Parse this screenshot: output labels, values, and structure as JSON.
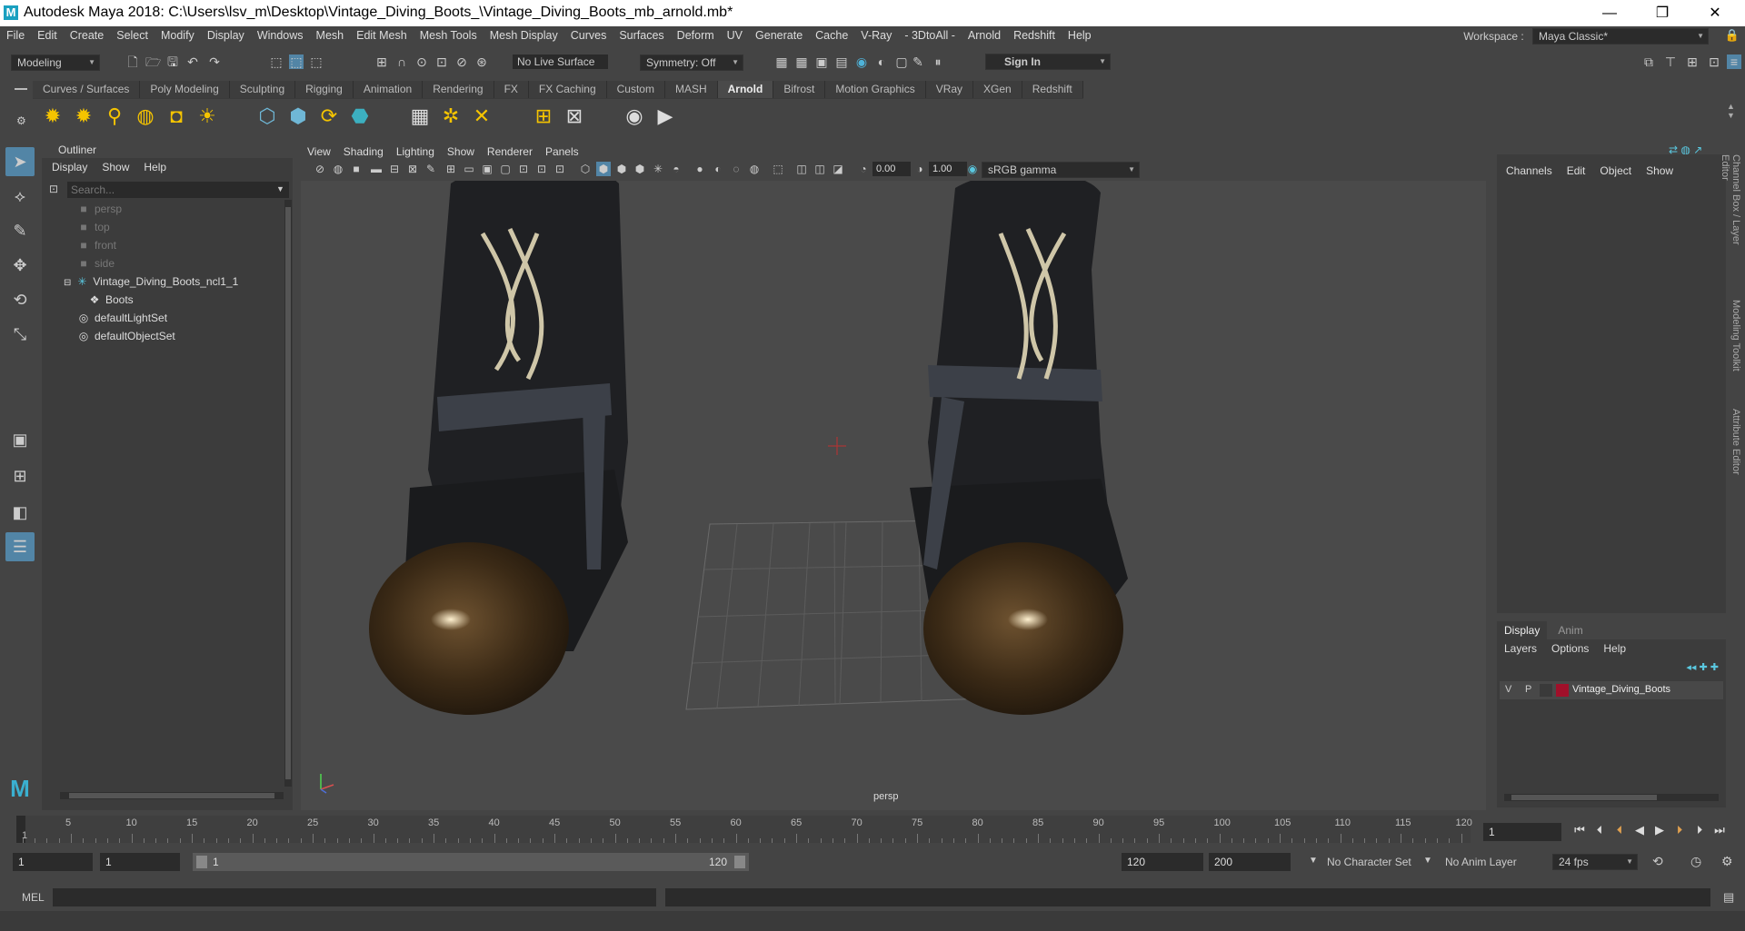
{
  "window": {
    "title": "Autodesk Maya 2018: C:\\Users\\lsv_m\\Desktop\\Vintage_Diving_Boots_\\Vintage_Diving_Boots_mb_arnold.mb*",
    "logo": "M"
  },
  "menubar": {
    "items": [
      "File",
      "Edit",
      "Create",
      "Select",
      "Modify",
      "Display",
      "Windows",
      "Mesh",
      "Edit Mesh",
      "Mesh Tools",
      "Mesh Display",
      "Curves",
      "Surfaces",
      "Deform",
      "UV",
      "Generate",
      "Cache",
      "V-Ray",
      "- 3DtoAll -",
      "Arnold",
      "Redshift",
      "Help"
    ],
    "workspace_label": "Workspace :",
    "workspace_value": "Maya Classic*"
  },
  "statusline": {
    "mode": "Modeling",
    "live_surface": "No Live Surface",
    "symmetry": "Symmetry: Off",
    "sign_in": "Sign In"
  },
  "shelf": {
    "tabs": [
      "Curves / Surfaces",
      "Poly Modeling",
      "Sculpting",
      "Rigging",
      "Animation",
      "Rendering",
      "FX",
      "FX Caching",
      "Custom",
      "MASH",
      "Arnold",
      "Bifrost",
      "Motion Graphics",
      "VRay",
      "XGen",
      "Redshift"
    ],
    "active_tab": "Arnold"
  },
  "outliner": {
    "title": "Outliner",
    "menu": [
      "Display",
      "Show",
      "Help"
    ],
    "search_placeholder": "Search...",
    "items": [
      {
        "label": "persp",
        "icon": "camera-icon"
      },
      {
        "label": "top",
        "icon": "camera-icon"
      },
      {
        "label": "front",
        "icon": "camera-icon"
      },
      {
        "label": "side",
        "icon": "camera-icon"
      },
      {
        "label": "Vintage_Diving_Boots_ncl1_1",
        "icon": "group-icon"
      },
      {
        "label": "Boots",
        "icon": "mesh-icon"
      },
      {
        "label": "defaultLightSet",
        "icon": "set-icon"
      },
      {
        "label": "defaultObjectSet",
        "icon": "set-icon"
      }
    ]
  },
  "viewport": {
    "menu": [
      "View",
      "Shading",
      "Lighting",
      "Show",
      "Renderer",
      "Panels"
    ],
    "exposure": "0.00",
    "gamma": "1.00",
    "color_space": "sRGB gamma",
    "camera_label": "persp"
  },
  "channelbox": {
    "menu": [
      "Channels",
      "Edit",
      "Object",
      "Show"
    ]
  },
  "layereditor": {
    "tabs": [
      "Display",
      "Anim"
    ],
    "menu": [
      "Layers",
      "Options",
      "Help"
    ],
    "layer": {
      "v": "V",
      "p": "P",
      "name": "Vintage_Diving_Boots",
      "color": "#a0102a"
    }
  },
  "sidebar_tabs": [
    "Channel Box / Layer Editor",
    "Modeling Toolkit",
    "Attribute Editor"
  ],
  "timeline": {
    "ticks": [
      "5",
      "10",
      "15",
      "20",
      "25",
      "30",
      "35",
      "40",
      "45",
      "50",
      "55",
      "60",
      "65",
      "70",
      "75",
      "80",
      "85",
      "90",
      "95",
      "100",
      "105",
      "110",
      "115",
      "120"
    ],
    "start_marker": "1",
    "current_frame": "1"
  },
  "range": {
    "start": "1",
    "anim_start": "1",
    "range_start": "1",
    "range_end": "120",
    "end": "120",
    "anim_end": "200",
    "character_set": "No Character Set",
    "anim_layer": "No Anim Layer",
    "fps": "24 fps"
  },
  "cmdline": {
    "label": "MEL"
  }
}
